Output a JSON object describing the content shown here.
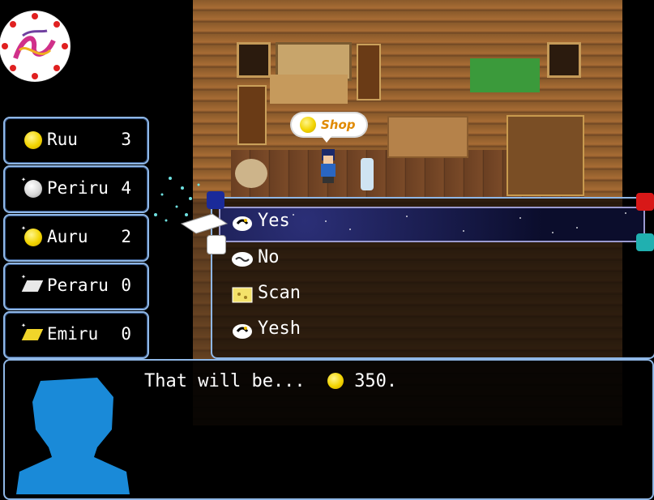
{
  "shop_bubble": {
    "label": "Shop"
  },
  "currencies": [
    {
      "name": "Ruu",
      "value": "3",
      "icon": "gold-coin-icon"
    },
    {
      "name": "Periru",
      "value": "4",
      "icon": "silver-coin-icon"
    },
    {
      "name": "Auru",
      "value": "2",
      "icon": "gold-coin-icon"
    },
    {
      "name": "Peraru",
      "value": "0",
      "icon": "white-gem-icon"
    },
    {
      "name": "Emiru",
      "value": "0",
      "icon": "yellow-gem-icon"
    }
  ],
  "choices": [
    {
      "label": "Yes",
      "icon": "thinking-emote-icon",
      "selected": true
    },
    {
      "label": "No",
      "icon": "speech-bubble-icon",
      "selected": false
    },
    {
      "label": "Scan",
      "icon": "cheese-map-icon",
      "selected": false
    },
    {
      "label": "Yesh",
      "icon": "thinking-emote-icon",
      "selected": false
    }
  ],
  "message": {
    "prefix": "That will be...",
    "amount": "350."
  },
  "colors": {
    "window_border": "#8fb7e6",
    "coin": "#f2d400",
    "selection": "#2b2f77"
  }
}
